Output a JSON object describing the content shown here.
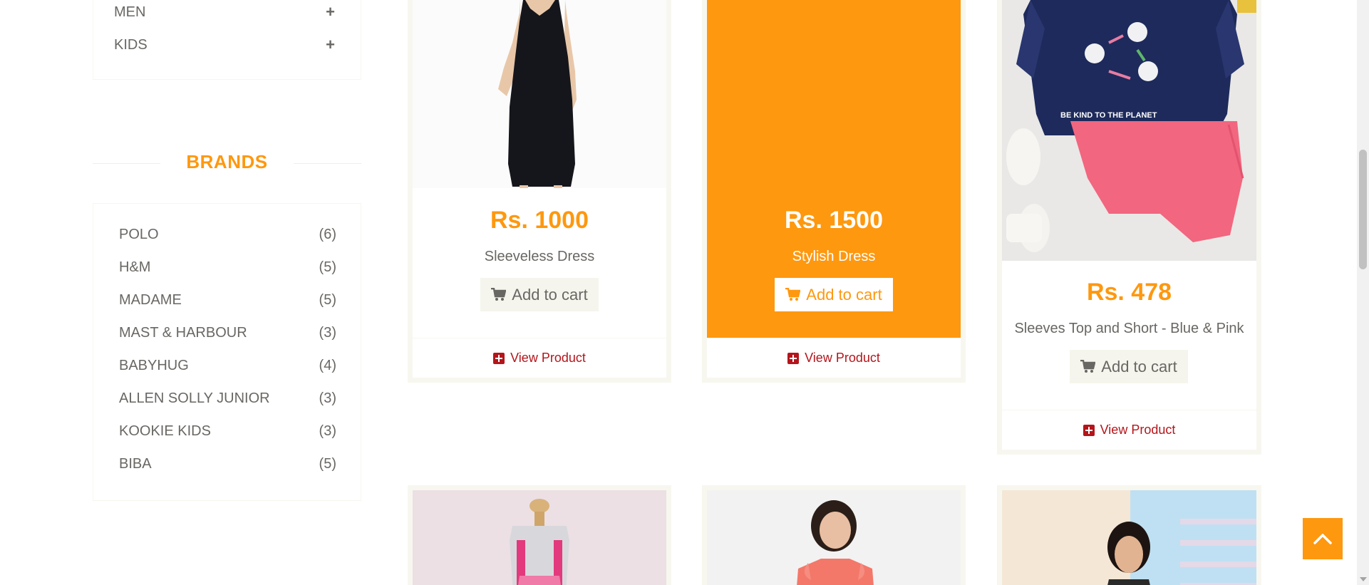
{
  "categories": [
    {
      "label": "MEN",
      "toggle": "+"
    },
    {
      "label": "KIDS",
      "toggle": "+"
    }
  ],
  "brands": {
    "heading": "BRANDS",
    "items": [
      {
        "name": "POLO",
        "count": "(6)"
      },
      {
        "name": "H&M",
        "count": "(5)"
      },
      {
        "name": "MADAME",
        "count": "(5)"
      },
      {
        "name": "MAST & HARBOUR",
        "count": "(3)"
      },
      {
        "name": "BABYHUG",
        "count": "(4)"
      },
      {
        "name": "ALLEN SOLLY JUNIOR",
        "count": "(3)"
      },
      {
        "name": "KOOKIE KIDS",
        "count": "(3)"
      },
      {
        "name": "BIBA",
        "count": "(5)"
      }
    ]
  },
  "products": [
    {
      "price": "Rs. 1000",
      "name": "Sleeveless Dress",
      "cart_label": "Add to cart",
      "view_label": "View Product"
    },
    {
      "price": "Rs. 1500",
      "name": "Stylish Dress",
      "cart_label": "Add to cart",
      "view_label": "View Product"
    },
    {
      "price": "Rs. 478",
      "name": "Sleeves Top and Short - Blue & Pink",
      "cart_label": "Add to cart",
      "view_label": "View Product"
    }
  ],
  "colors": {
    "accent": "#fe980f",
    "link": "#b4151b",
    "text": "#696763"
  }
}
